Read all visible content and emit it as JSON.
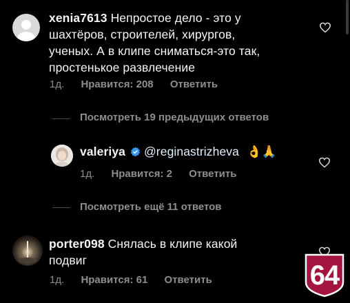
{
  "comments": [
    {
      "username": "xenia7613",
      "text_line1": "Непростое дело - это у",
      "text_line2": "шахтёров, строителей, хирургов,",
      "text_line3": "ученых. А в клипе сниматься-это так,",
      "text_line4": "простенькое развлечение",
      "time": "1д.",
      "likes": "Нравится: 208",
      "reply": "Ответить"
    },
    {
      "username": "valeriya",
      "verified": true,
      "mention": "@reginastrizheva",
      "emoji": "👌🙏",
      "time": "1д.",
      "likes": "Нравится: 2",
      "reply": "Ответить"
    },
    {
      "username": "porter098",
      "text_line1": "Снялась в клипе какой",
      "text_line2": "подвиг",
      "time": "1д.",
      "likes": "Нравится: 61",
      "reply": "Ответить"
    }
  ],
  "view_previous": "Посмотреть 19 предыдущих ответов",
  "view_more": "Посмотреть ещё 11 ответов",
  "badge": "64",
  "icons": {
    "heart": "heart-outline-icon",
    "verified": "verified-badge-icon"
  },
  "colors": {
    "background": "#000000",
    "meta": "#8e8e8e",
    "verified": "#3897f0",
    "badge": "#a3143f"
  }
}
